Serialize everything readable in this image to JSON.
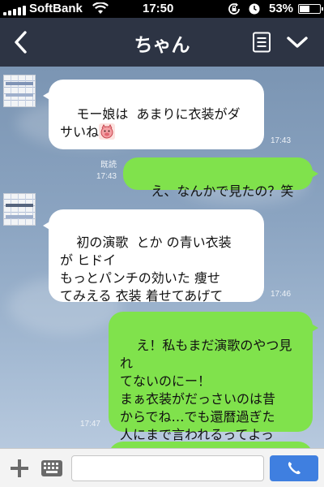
{
  "status_bar": {
    "carrier": "SoftBank",
    "time": "17:50",
    "battery": "53%",
    "battery_level": 0.53
  },
  "header": {
    "title": "ちゃん",
    "back_icon": "chevron-left-icon",
    "menu_icon": "list-icon",
    "more_icon": "chevron-down-icon"
  },
  "messages": [
    {
      "side": "in",
      "text": "モー娘は  あまりに衣装がダ\nサいね",
      "sticker": "pig-face-sticker",
      "time": "17:43"
    },
    {
      "side": "out",
      "text": "え、なんかで見たの？笑",
      "read": "既読",
      "time": "17:43"
    },
    {
      "side": "in",
      "text": "初の演歌  とか の青い衣装\nが ヒドイ\nもっとパンチの効いた 痩せ\nてみえる 衣装 着せてあげて",
      "time": "17:46"
    },
    {
      "side": "out",
      "text": "え！私もまだ演歌のやつ見れ\nてないのにー！\nまぁ衣装がだっさいのは昔\nからでね…でも還暦過ぎた\n人にまで言われるってよっ\nぽどなんだな笑",
      "time": "17:47"
    }
  ],
  "input_bar": {
    "placeholder": "",
    "plus_icon": "plus-icon",
    "keyboard_icon": "keyboard-icon",
    "call_icon": "phone-icon"
  },
  "colors": {
    "header_bg": "#2d3444",
    "outgoing_bubble": "#80e24c",
    "incoming_bubble": "#ffffff",
    "call_button": "#3f7fe0"
  }
}
